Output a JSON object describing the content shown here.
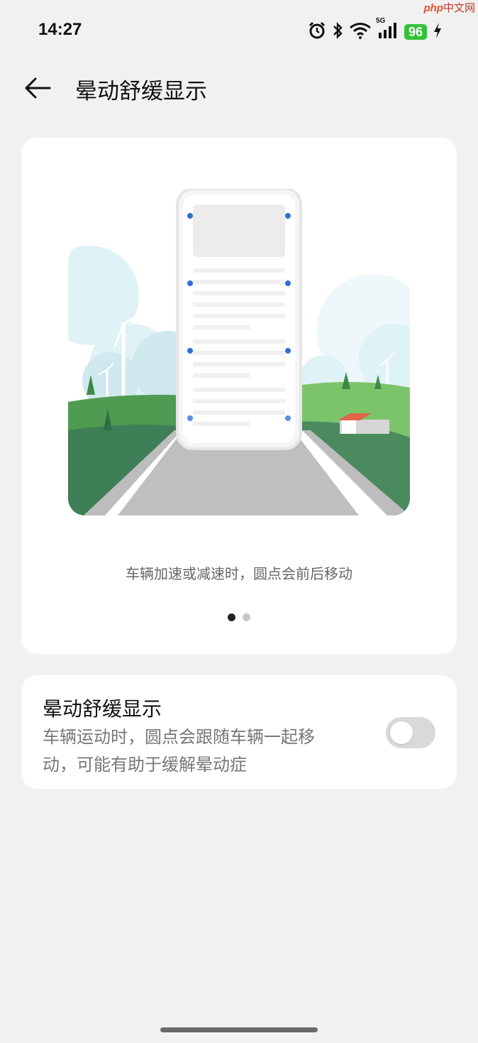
{
  "status_bar": {
    "time": "14:27",
    "battery": "96",
    "network": "5G",
    "icons": [
      "alarm-icon",
      "bluetooth-icon",
      "wifi-icon",
      "signal-icon",
      "battery-icon",
      "charging-icon"
    ]
  },
  "watermark": {
    "brand": "php",
    "suffix": "中文网"
  },
  "header": {
    "title": "晕动舒缓显示",
    "back_icon": "back-arrow-icon"
  },
  "illustration": {
    "caption": "车辆加速或减速时，圆点会前后移动",
    "pager": {
      "count": 2,
      "active": 0
    }
  },
  "setting": {
    "title": "晕动舒缓显示",
    "description": "车辆运动时，圆点会跟随车辆一起移动，可能有助于缓解晕动症",
    "enabled": false
  },
  "colors": {
    "accent_dot": "#2f6fd6",
    "toggle_off": "#d9d9d9",
    "battery": "#31c23a"
  }
}
